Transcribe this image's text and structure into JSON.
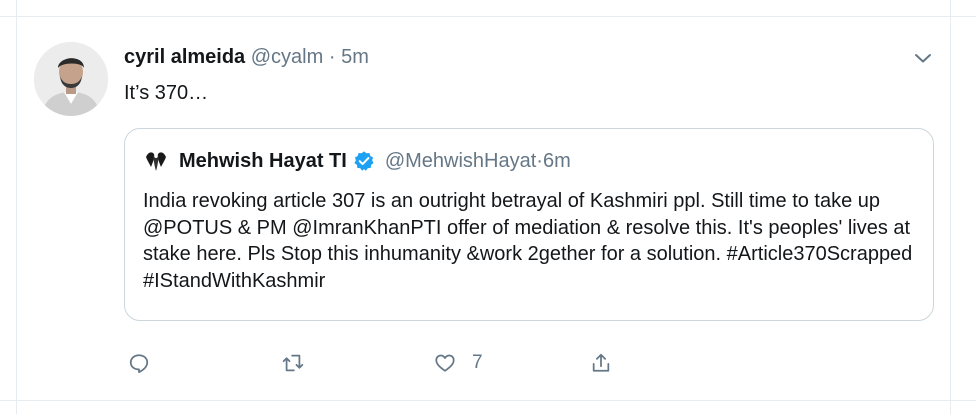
{
  "tweet": {
    "author_name": "cyril almeida",
    "handle": "@cyalm",
    "separator": "·",
    "time": "5m",
    "text": "It’s 370…"
  },
  "quote": {
    "author_name": "Mehwish Hayat TI",
    "handle": "@MehwishHayat",
    "separator": "·",
    "time": "6m",
    "text": "India revoking article 307 is an outright betrayal of Kashmiri ppl. Still time to take up @POTUS & PM @ImranKhanPTI offer of mediation & resolve this. It's peoples' lives at stake here. Pls Stop this inhumanity &work 2gether for a solution. #Article370Scrapped #IStandWithKashmir"
  },
  "actions": {
    "reply_icon": "reply-icon",
    "retweet_icon": "retweet-icon",
    "like_icon": "heart-icon",
    "like_count": "7",
    "share_icon": "share-icon"
  },
  "colors": {
    "text": "#14171a",
    "muted": "#657786",
    "border": "#ccd6dd",
    "verified": "#1da1f2"
  }
}
